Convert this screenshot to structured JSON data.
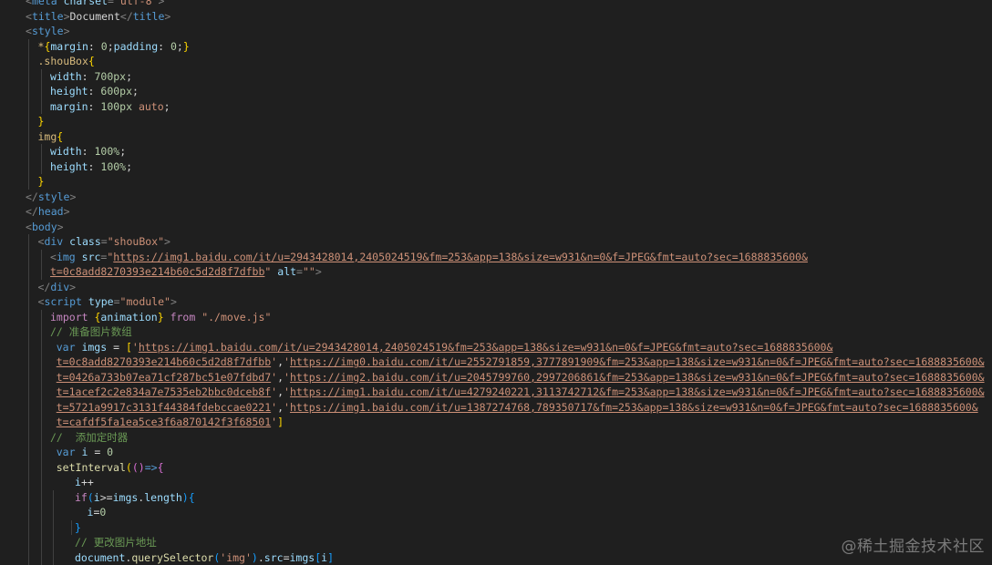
{
  "watermark": "@稀土掘金技术社区",
  "lines": [
    {
      "indent": 0,
      "tokens": [
        [
          "punct",
          "<"
        ],
        [
          "tag",
          "meta"
        ],
        [
          "attr",
          " charset"
        ],
        [
          "punct",
          "="
        ],
        [
          "str",
          "\"utf-8\""
        ],
        [
          "punct",
          ">"
        ]
      ]
    },
    {
      "indent": 0,
      "tokens": [
        [
          "punct",
          "<"
        ],
        [
          "tag",
          "title"
        ],
        [
          "punct",
          ">"
        ],
        [
          "text",
          "Document"
        ],
        [
          "punct",
          "</"
        ],
        [
          "tag",
          "title"
        ],
        [
          "punct",
          ">"
        ]
      ]
    },
    {
      "indent": 0,
      "tokens": [
        [
          "punct",
          "<"
        ],
        [
          "tag",
          "style"
        ],
        [
          "punct",
          ">"
        ]
      ]
    },
    {
      "indent": 1,
      "tokens": [
        [
          "sel",
          "*"
        ],
        [
          "brace",
          "{"
        ],
        [
          "prop",
          "margin"
        ],
        [
          "op",
          ": "
        ],
        [
          "num",
          "0"
        ],
        [
          "op",
          ";"
        ],
        [
          "prop",
          "padding"
        ],
        [
          "op",
          ": "
        ],
        [
          "num",
          "0"
        ],
        [
          "op",
          ";"
        ],
        [
          "brace",
          "}"
        ]
      ]
    },
    {
      "indent": 1,
      "tokens": [
        [
          "sel",
          ".shouBox"
        ],
        [
          "brace",
          "{"
        ]
      ]
    },
    {
      "indent": 2,
      "tokens": [
        [
          "prop",
          "width"
        ],
        [
          "op",
          ": "
        ],
        [
          "num",
          "700px"
        ],
        [
          "op",
          ";"
        ]
      ]
    },
    {
      "indent": 2,
      "tokens": [
        [
          "prop",
          "height"
        ],
        [
          "op",
          ": "
        ],
        [
          "num",
          "600px"
        ],
        [
          "op",
          ";"
        ]
      ]
    },
    {
      "indent": 2,
      "tokens": [
        [
          "prop",
          "margin"
        ],
        [
          "op",
          ": "
        ],
        [
          "num",
          "100px"
        ],
        [
          "str",
          " auto"
        ],
        [
          "op",
          ";"
        ]
      ]
    },
    {
      "indent": 1,
      "tokens": [
        [
          "brace",
          "}"
        ]
      ]
    },
    {
      "indent": 1,
      "tokens": [
        [
          "sel",
          "img"
        ],
        [
          "brace",
          "{"
        ]
      ]
    },
    {
      "indent": 2,
      "tokens": [
        [
          "prop",
          "width"
        ],
        [
          "op",
          ": "
        ],
        [
          "num",
          "100%"
        ],
        [
          "op",
          ";"
        ]
      ]
    },
    {
      "indent": 2,
      "tokens": [
        [
          "prop",
          "height"
        ],
        [
          "op",
          ": "
        ],
        [
          "num",
          "100%"
        ],
        [
          "op",
          ";"
        ]
      ]
    },
    {
      "indent": 1,
      "tokens": [
        [
          "brace",
          "}"
        ]
      ]
    },
    {
      "indent": 0,
      "tokens": [
        [
          "punct",
          "</"
        ],
        [
          "tag",
          "style"
        ],
        [
          "punct",
          ">"
        ]
      ]
    },
    {
      "indent": 0,
      "tokens": [
        [
          "punct",
          "</"
        ],
        [
          "tag",
          "head"
        ],
        [
          "punct",
          ">"
        ]
      ]
    },
    {
      "indent": 0,
      "tokens": [
        [
          "punct",
          "<"
        ],
        [
          "tag",
          "body"
        ],
        [
          "punct",
          ">"
        ]
      ]
    },
    {
      "indent": 1,
      "tokens": [
        [
          "punct",
          "<"
        ],
        [
          "tag",
          "div"
        ],
        [
          "attr",
          " class"
        ],
        [
          "punct",
          "="
        ],
        [
          "str",
          "\"shouBox\""
        ],
        [
          "punct",
          ">"
        ]
      ]
    },
    {
      "indent": 2,
      "tokens": [
        [
          "punct",
          "<"
        ],
        [
          "tag",
          "img"
        ],
        [
          "attr",
          " src"
        ],
        [
          "punct",
          "="
        ],
        [
          "str",
          "\""
        ],
        [
          "url",
          "https://img1.baidu.com/it/u=2943428014,2405024519&fm=253&app=138&size=w931&n=0&f=JPEG&fmt=auto?sec=1688835600&"
        ]
      ]
    },
    {
      "indent": 2,
      "tokens": [
        [
          "url",
          "t=0c8add8270393e214b60c5d2d8f7dfbb"
        ],
        [
          "str",
          "\""
        ],
        [
          "attr",
          " alt"
        ],
        [
          "punct",
          "="
        ],
        [
          "str",
          "\"\""
        ],
        [
          "punct",
          ">"
        ]
      ]
    },
    {
      "indent": 1,
      "tokens": [
        [
          "punct",
          "</"
        ],
        [
          "tag",
          "div"
        ],
        [
          "punct",
          ">"
        ]
      ]
    },
    {
      "indent": 1,
      "tokens": [
        [
          "punct",
          "<"
        ],
        [
          "tag",
          "script"
        ],
        [
          "attr",
          " type"
        ],
        [
          "punct",
          "="
        ],
        [
          "str",
          "\"module\""
        ],
        [
          "punct",
          ">"
        ]
      ]
    },
    {
      "indent": 2,
      "tokens": [
        [
          "ctrl",
          "import "
        ],
        [
          "brace",
          "{"
        ],
        [
          "var",
          "animation"
        ],
        [
          "brace",
          "}"
        ],
        [
          "ctrl",
          " from "
        ],
        [
          "str",
          "\"./move.js\""
        ]
      ]
    },
    {
      "indent": 2,
      "tokens": [
        [
          "comment",
          "// 准备图片数组"
        ]
      ]
    },
    {
      "indent": 2.5,
      "tokens": [
        [
          "kw",
          "var "
        ],
        [
          "var",
          "imgs"
        ],
        [
          "op",
          " = "
        ],
        [
          "brace",
          "["
        ],
        [
          "str",
          "'"
        ],
        [
          "url",
          "https://img1.baidu.com/it/u=2943428014,2405024519&fm=253&app=138&size=w931&n=0&f=JPEG&fmt=auto?sec=1688835600&"
        ]
      ]
    },
    {
      "indent": 2.5,
      "tokens": [
        [
          "url",
          "t=0c8add8270393e214b60c5d2d8f7dfbb"
        ],
        [
          "str",
          "'"
        ],
        [
          "op",
          ","
        ],
        [
          "str",
          "'"
        ],
        [
          "url",
          "https://img0.baidu.com/it/u=2552791859,3777891909&fm=253&app=138&size=w931&n=0&f=JPEG&fmt=auto?sec=1688835600&"
        ]
      ]
    },
    {
      "indent": 2.5,
      "tokens": [
        [
          "url",
          "t=0426a733b07ea71cf287bc51e07fdbd7"
        ],
        [
          "str",
          "'"
        ],
        [
          "op",
          ","
        ],
        [
          "str",
          "'"
        ],
        [
          "url",
          "https://img2.baidu.com/it/u=2045799760,2997206861&fm=253&app=138&size=w931&n=0&f=JPEG&fmt=auto?sec=1688835600&"
        ]
      ]
    },
    {
      "indent": 2.5,
      "tokens": [
        [
          "url",
          "t=1acef2c2e834a7e7535eb2bbc0dceb8f"
        ],
        [
          "str",
          "'"
        ],
        [
          "op",
          ","
        ],
        [
          "str",
          "'"
        ],
        [
          "url",
          "https://img1.baidu.com/it/u=4279240221,3113742712&fm=253&app=138&size=w931&n=0&f=JPEG&fmt=auto?sec=1688835600&"
        ]
      ]
    },
    {
      "indent": 2.5,
      "tokens": [
        [
          "url",
          "t=5721a9917c3131f44384fdebccae0221"
        ],
        [
          "str",
          "'"
        ],
        [
          "op",
          ","
        ],
        [
          "str",
          "'"
        ],
        [
          "url",
          "https://img1.baidu.com/it/u=1387274768,789350717&fm=253&app=138&size=w931&n=0&f=JPEG&fmt=auto?sec=1688835600&"
        ]
      ]
    },
    {
      "indent": 2.5,
      "tokens": [
        [
          "url",
          "t=cafdf5fa1ea5ce3f6a870142f3f68501"
        ],
        [
          "str",
          "'"
        ],
        [
          "brace",
          "]"
        ]
      ]
    },
    {
      "indent": 2,
      "tokens": [
        [
          "comment",
          "//  添加定时器"
        ]
      ]
    },
    {
      "indent": 2.5,
      "tokens": [
        [
          "kw",
          "var "
        ],
        [
          "var",
          "i"
        ],
        [
          "op",
          " = "
        ],
        [
          "num",
          "0"
        ]
      ]
    },
    {
      "indent": 2.5,
      "tokens": [
        [
          "fn",
          "setInterval"
        ],
        [
          "brace",
          "("
        ],
        [
          "brace2",
          "()"
        ],
        [
          "kw",
          "=>"
        ],
        [
          "brace2",
          "{"
        ]
      ]
    },
    {
      "indent": 4,
      "tokens": [
        [
          "var",
          "i"
        ],
        [
          "op",
          "++"
        ]
      ]
    },
    {
      "indent": 4,
      "tokens": [
        [
          "ctrl",
          "if"
        ],
        [
          "brace3",
          "("
        ],
        [
          "var",
          "i"
        ],
        [
          "op",
          ">="
        ],
        [
          "var",
          "imgs"
        ],
        [
          "op",
          "."
        ],
        [
          "var",
          "length"
        ],
        [
          "brace3",
          "){"
        ]
      ]
    },
    {
      "indent": 5,
      "tokens": [
        [
          "var",
          "i"
        ],
        [
          "op",
          "="
        ],
        [
          "num",
          "0"
        ]
      ]
    },
    {
      "indent": 4,
      "tokens": [
        [
          "brace3",
          "}"
        ]
      ]
    },
    {
      "indent": 4,
      "tokens": [
        [
          "comment",
          "// 更改图片地址"
        ]
      ]
    },
    {
      "indent": 4,
      "tokens": [
        [
          "var",
          "document"
        ],
        [
          "op",
          "."
        ],
        [
          "fn",
          "querySelector"
        ],
        [
          "brace3",
          "("
        ],
        [
          "str",
          "'img'"
        ],
        [
          "brace3",
          ")"
        ],
        [
          "op",
          "."
        ],
        [
          "var",
          "src"
        ],
        [
          "op",
          "="
        ],
        [
          "var",
          "imgs"
        ],
        [
          "brace3",
          "["
        ],
        [
          "var",
          "i"
        ],
        [
          "brace3",
          "]"
        ]
      ]
    }
  ]
}
